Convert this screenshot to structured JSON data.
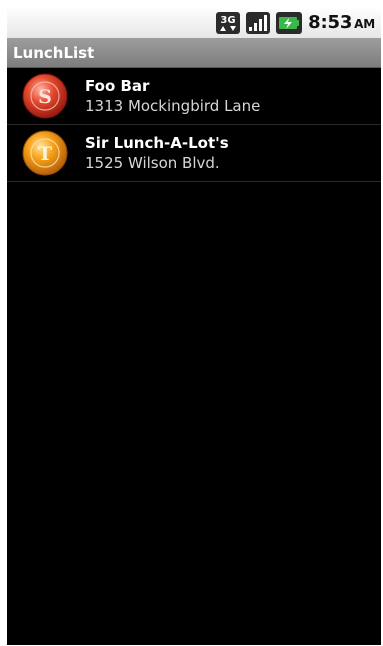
{
  "status_bar": {
    "network_label": "3G",
    "icons": [
      "3g-data-icon",
      "signal-strength-icon",
      "battery-charging-icon"
    ],
    "time": "8:53",
    "ampm": "AM"
  },
  "app": {
    "title": "LunchList"
  },
  "restaurants": [
    {
      "name": "Foo Bar",
      "address": "1313 Mockingbird Lane",
      "type_letter": "S",
      "color": "#e0402a"
    },
    {
      "name": "Sir Lunch-A-Lot's",
      "address": "1525 Wilson Blvd.",
      "type_letter": "T",
      "color": "#f39a10"
    }
  ],
  "colors": {
    "background": "#000000",
    "title_bar": "#8a8a8a",
    "status_bar": "#f2f2f2"
  }
}
